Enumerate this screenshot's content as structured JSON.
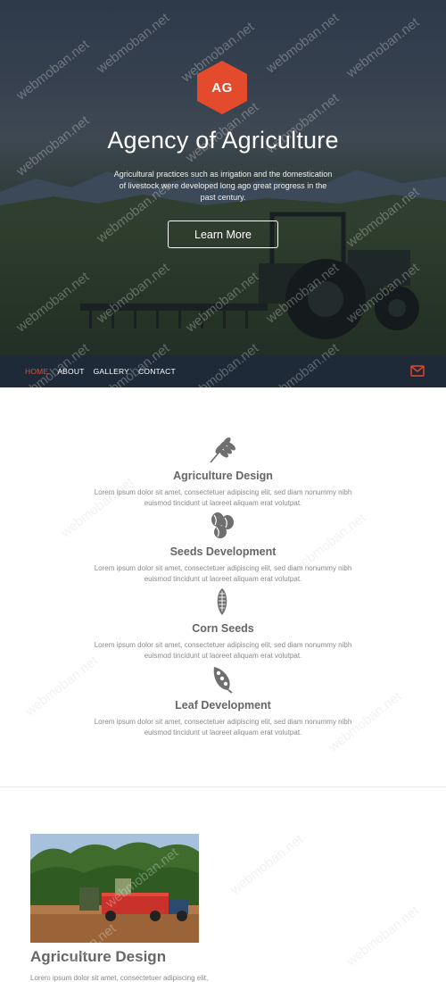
{
  "hero": {
    "logo_text": "AG",
    "title": "Agency of Agriculture",
    "description": "Agricultural practices such as irrigation and the domestication of livestock were developed long ago great progress in the past century.",
    "button_label": "Learn More"
  },
  "nav": {
    "items": [
      {
        "label": "HOME",
        "active": true
      },
      {
        "label": "ABOUT",
        "active": false
      },
      {
        "label": "GALLERY",
        "active": false
      },
      {
        "label": "CONTACT",
        "active": false
      }
    ],
    "mail_icon": "envelope-icon"
  },
  "features": [
    {
      "icon": "wheat-icon",
      "title": "Agriculture Design",
      "text": "Lorem ipsum dolor sit amet, consectetuer adipiscing elit, sed diam nonummy nibh euismod tincidunt ut laoreet aliquam erat volutpat."
    },
    {
      "icon": "seeds-icon",
      "title": "Seeds Development",
      "text": "Lorem ipsum dolor sit amet, consectetuer adipiscing elit, sed diam nonummy nibh euismod tincidunt ut laoreet aliquam erat volutpat."
    },
    {
      "icon": "corn-icon",
      "title": "Corn Seeds",
      "text": "Lorem ipsum dolor sit amet, consectetuer adipiscing elit, sed diam nonummy nibh euismod tincidunt ut laoreet aliquam erat volutpat."
    },
    {
      "icon": "leaf-icon",
      "title": "Leaf Development",
      "text": "Lorem ipsum dolor sit amet, consectetuer adipiscing elit, sed diam nonummy nibh euismod tincidunt ut laoreet aliquam erat volutpat."
    }
  ],
  "blog": {
    "title": "Agriculture Design",
    "excerpt": "Lorem ipsum dolor sit amet, consectetuer adipiscing elit,"
  },
  "watermark_text": "webmoban.net",
  "colors": {
    "accent": "#e44b2c",
    "nav_bg": "#1f2a38"
  }
}
